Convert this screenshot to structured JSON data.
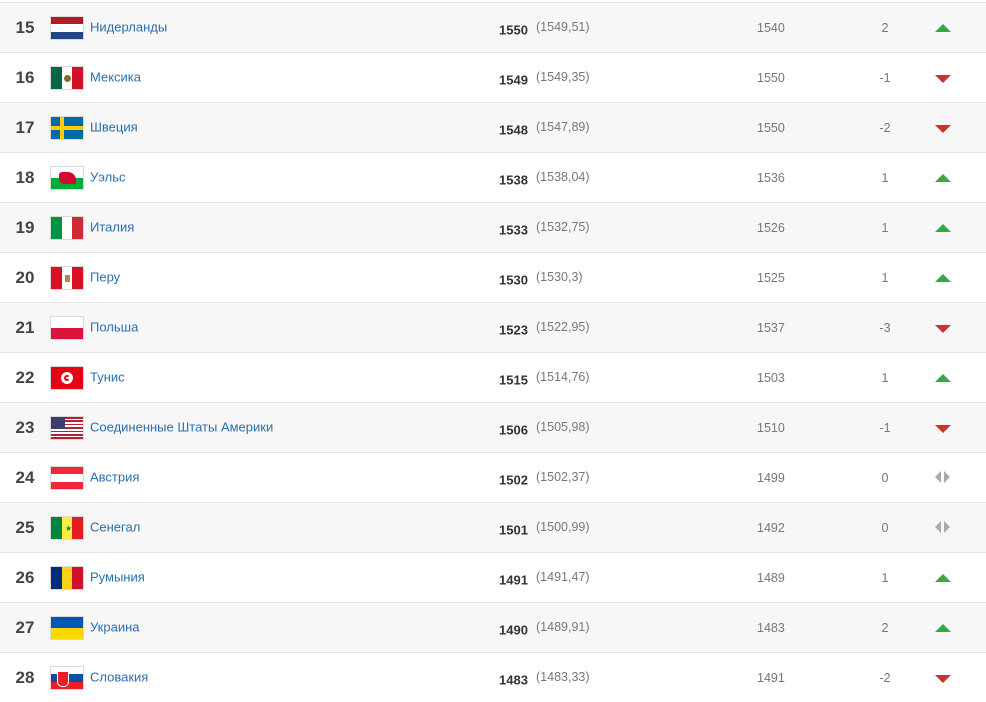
{
  "rows": [
    {
      "rank": "15",
      "name": "Нидерланды",
      "points": "1550",
      "points_exact": "(1549,51)",
      "previous": "1540",
      "delta": "2",
      "trend": "up",
      "flag": "nl"
    },
    {
      "rank": "16",
      "name": "Мексика",
      "points": "1549",
      "points_exact": "(1549,35)",
      "previous": "1550",
      "delta": "-1",
      "trend": "down",
      "flag": "mx"
    },
    {
      "rank": "17",
      "name": "Швеция",
      "points": "1548",
      "points_exact": "(1547,89)",
      "previous": "1550",
      "delta": "-2",
      "trend": "down",
      "flag": "se"
    },
    {
      "rank": "18",
      "name": "Уэльс",
      "points": "1538",
      "points_exact": "(1538,04)",
      "previous": "1536",
      "delta": "1",
      "trend": "up",
      "flag": "wales"
    },
    {
      "rank": "19",
      "name": "Италия",
      "points": "1533",
      "points_exact": "(1532,75)",
      "previous": "1526",
      "delta": "1",
      "trend": "up",
      "flag": "it"
    },
    {
      "rank": "20",
      "name": "Перу",
      "points": "1530",
      "points_exact": "(1530,3)",
      "previous": "1525",
      "delta": "1",
      "trend": "up",
      "flag": "pe"
    },
    {
      "rank": "21",
      "name": "Польша",
      "points": "1523",
      "points_exact": "(1522,95)",
      "previous": "1537",
      "delta": "-3",
      "trend": "down",
      "flag": "pl"
    },
    {
      "rank": "22",
      "name": "Тунис",
      "points": "1515",
      "points_exact": "(1514,76)",
      "previous": "1503",
      "delta": "1",
      "trend": "up",
      "flag": "tn"
    },
    {
      "rank": "23",
      "name": "Соединенные Штаты Америки",
      "points": "1506",
      "points_exact": "(1505,98)",
      "previous": "1510",
      "delta": "-1",
      "trend": "down",
      "flag": "us"
    },
    {
      "rank": "24",
      "name": "Австрия",
      "points": "1502",
      "points_exact": "(1502,37)",
      "previous": "1499",
      "delta": "0",
      "trend": "same",
      "flag": "at"
    },
    {
      "rank": "25",
      "name": "Сенегал",
      "points": "1501",
      "points_exact": "(1500,99)",
      "previous": "1492",
      "delta": "0",
      "trend": "same",
      "flag": "sn"
    },
    {
      "rank": "26",
      "name": "Румыния",
      "points": "1491",
      "points_exact": "(1491,47)",
      "previous": "1489",
      "delta": "1",
      "trend": "up",
      "flag": "ro"
    },
    {
      "rank": "27",
      "name": "Украина",
      "points": "1490",
      "points_exact": "(1489,91)",
      "previous": "1483",
      "delta": "2",
      "trend": "up",
      "flag": "ua"
    },
    {
      "rank": "28",
      "name": "Словакия",
      "points": "1483",
      "points_exact": "(1483,33)",
      "previous": "1491",
      "delta": "-2",
      "trend": "down",
      "flag": "sk"
    }
  ]
}
